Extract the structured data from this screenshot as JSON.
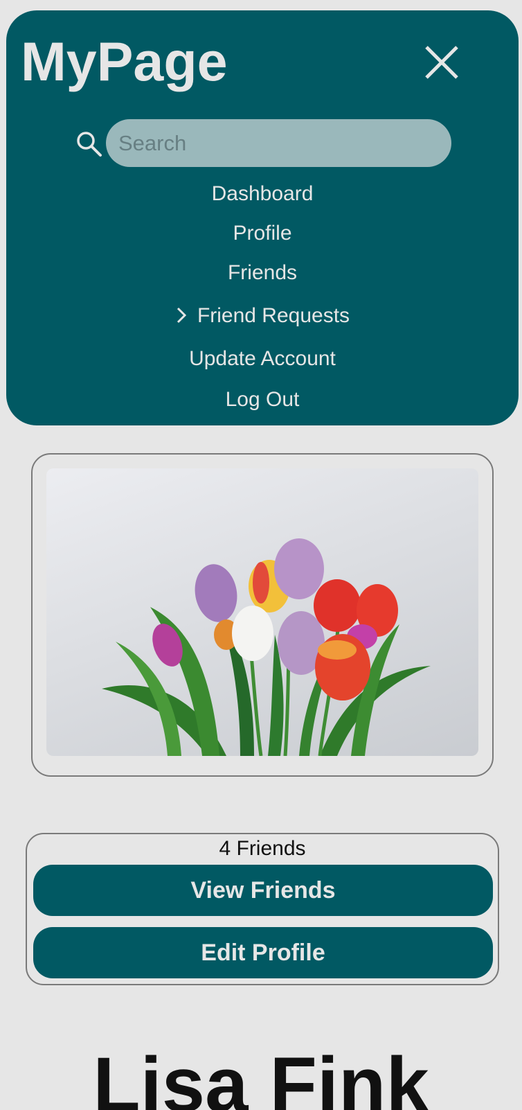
{
  "brand": {
    "title": "MyPage"
  },
  "search": {
    "placeholder": "Search"
  },
  "nav": {
    "items": [
      {
        "label": "Dashboard"
      },
      {
        "label": "Profile"
      },
      {
        "label": "Friends"
      },
      {
        "label": "Friend Requests"
      },
      {
        "label": "Update Account"
      },
      {
        "label": "Log Out"
      }
    ]
  },
  "profile": {
    "friends_count": "4 Friends",
    "view_friends_label": "View Friends",
    "edit_profile_label": "Edit Profile",
    "name": "Lisa Fink"
  },
  "icons": {
    "close": "close-icon",
    "search": "search-icon",
    "chevron": "chevron-right-icon"
  },
  "colors": {
    "primary": "#015963",
    "background": "#e6e6e6",
    "search_field": "#9ab8bb"
  }
}
